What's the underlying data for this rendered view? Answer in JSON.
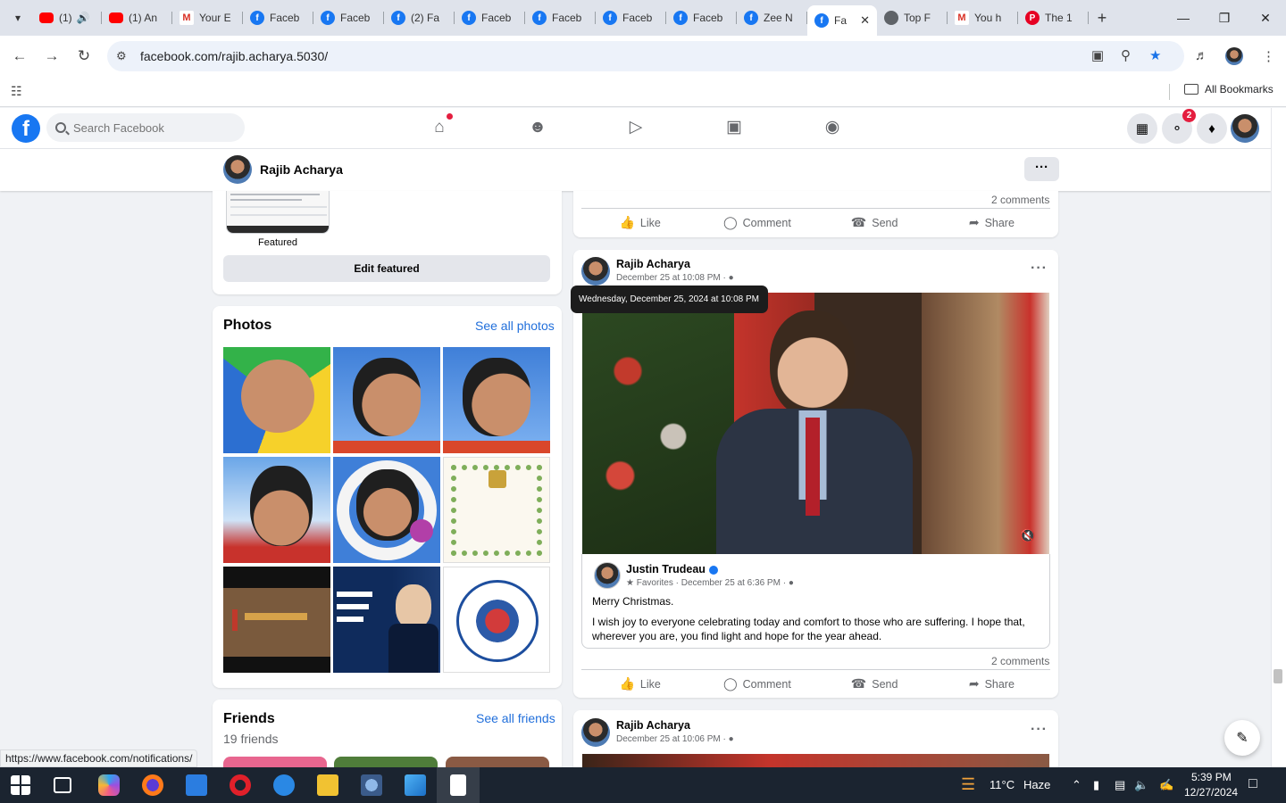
{
  "browser": {
    "tabs": [
      {
        "icon": "youtube",
        "label": "(1)"
      },
      {
        "icon": "youtube",
        "label": "(1) An"
      },
      {
        "icon": "gmail",
        "label": "Your E"
      },
      {
        "icon": "facebook",
        "label": "Faceb"
      },
      {
        "icon": "facebook",
        "label": "Faceb"
      },
      {
        "icon": "facebook",
        "label": "(2) Fa"
      },
      {
        "icon": "facebook",
        "label": "Faceb"
      },
      {
        "icon": "facebook",
        "label": "Faceb"
      },
      {
        "icon": "facebook",
        "label": "Faceb"
      },
      {
        "icon": "facebook",
        "label": "Faceb"
      },
      {
        "icon": "facebook",
        "label": "Zee N"
      },
      {
        "icon": "facebook",
        "label": "Fa",
        "active": true
      },
      {
        "icon": "top",
        "label": "Top F"
      },
      {
        "icon": "gmail",
        "label": "You h"
      },
      {
        "icon": "pinterest",
        "label": "The 1"
      }
    ],
    "url": "facebook.com/rajib.acharya.5030/",
    "bookmarks_label": "All Bookmarks",
    "status_url": "https://www.facebook.com/notifications/"
  },
  "fb": {
    "search_placeholder": "Search Facebook",
    "messenger_badge": "2",
    "profile_name": "Rajib Acharya"
  },
  "left": {
    "featured_label": "Featured",
    "edit_featured": "Edit featured",
    "photos_title": "Photos",
    "see_all_photos": "See all photos",
    "friends_title": "Friends",
    "see_all_friends": "See all friends",
    "friends_count": "19 friends"
  },
  "feed": {
    "top_comments": "2 comments",
    "actions": [
      "Like",
      "Comment",
      "Send",
      "Share"
    ],
    "post1": {
      "author": "Rajib Acharya",
      "time": "December 25 at 10:08 PM ·",
      "tooltip": "Wednesday, December 25, 2024 at 10:08 PM",
      "shared_author": "Justin Trudeau",
      "shared_meta": "Favorites · December 25 at 6:36 PM ·",
      "text1": "Merry Christmas.",
      "text2": "I wish joy to everyone celebrating today and comfort to those who are suffering. I hope that, wherever you are, you find light and hope for the year ahead.",
      "comments": "2 comments"
    },
    "post2": {
      "author": "Rajib Acharya",
      "time": "December 25 at 10:06 PM ·"
    }
  },
  "taskbar": {
    "temperature": "11°C",
    "weather": "Haze",
    "time": "5:39 PM",
    "date": "12/27/2024"
  },
  "colors": {
    "fb_blue": "#1877f2",
    "link_blue": "#216fdb",
    "taskbar": "#1b2430"
  }
}
